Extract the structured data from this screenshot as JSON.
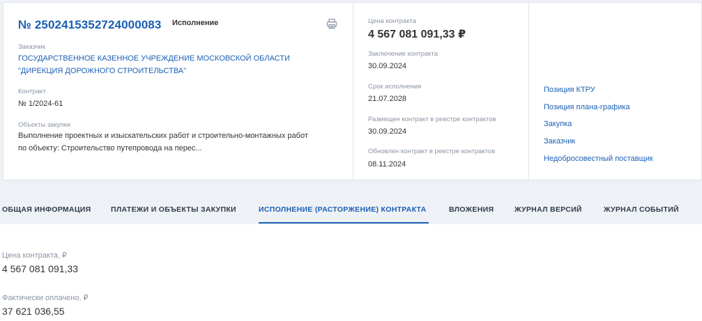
{
  "header": {
    "reg_number": "№ 2502415352724000083",
    "status": "Исполнение",
    "print_icon": "printer-icon"
  },
  "customer": {
    "label": "Заказчик",
    "line1": "ГОСУДАРСТВЕННОЕ КАЗЕННОЕ УЧРЕЖДЕНИЕ МОСКОВСКОЙ ОБЛАСТИ",
    "line2": "\"ДИРЕКЦИЯ ДОРОЖНОГО СТРОИТЕЛЬСТВА\""
  },
  "contract": {
    "label": "Контракт",
    "value": "№ 1/2024-61"
  },
  "objects": {
    "label": "Объекты закупки",
    "line1": "Выполнение проектных и изыскательских работ и строительно-монтажных работ",
    "line2": "по объекту: Строительство путепровода на перес..."
  },
  "details": {
    "price_label": "Цена контракта",
    "price_value": "4 567 081 091,33 ₽",
    "conclusion_label": "Заключение контракта",
    "conclusion_value": "30.09.2024",
    "term_label": "Срок исполнения",
    "term_value": "21.07.2028",
    "placed_label": "Размещен контракт в реестре контрактов",
    "placed_value": "30.09.2024",
    "updated_label": "Обновлен контракт в реестре контрактов",
    "updated_value": "08.11.2024"
  },
  "links": [
    "Позиция КТРУ",
    "Позиция плана-графика",
    "Закупка",
    "Заказчик",
    "Недобросовестный поставщик"
  ],
  "tabs": [
    "ОБЩАЯ ИНФОРМАЦИЯ",
    "ПЛАТЕЖИ И ОБЪЕКТЫ ЗАКУПКИ",
    "ИСПОЛНЕНИЕ (РАСТОРЖЕНИЕ) КОНТРАКТА",
    "ВЛОЖЕНИЯ",
    "ЖУРНАЛ ВЕРСИЙ",
    "ЖУРНАЛ СОБЫТИЙ"
  ],
  "active_tab": "ИСПОЛНЕНИЕ (РАСТОРЖЕНИЕ) КОНТРАКТА",
  "execution": {
    "price_label": "Цена контракта, ₽",
    "price_value": "4 567 081 091,33",
    "paid_label": "Фактически оплачено, ₽",
    "paid_value": "37 621 036,55"
  },
  "colors": {
    "accent": "#1a5fb4",
    "text": "#333333",
    "muted": "#8a94a3",
    "background": "#eef1f5"
  }
}
